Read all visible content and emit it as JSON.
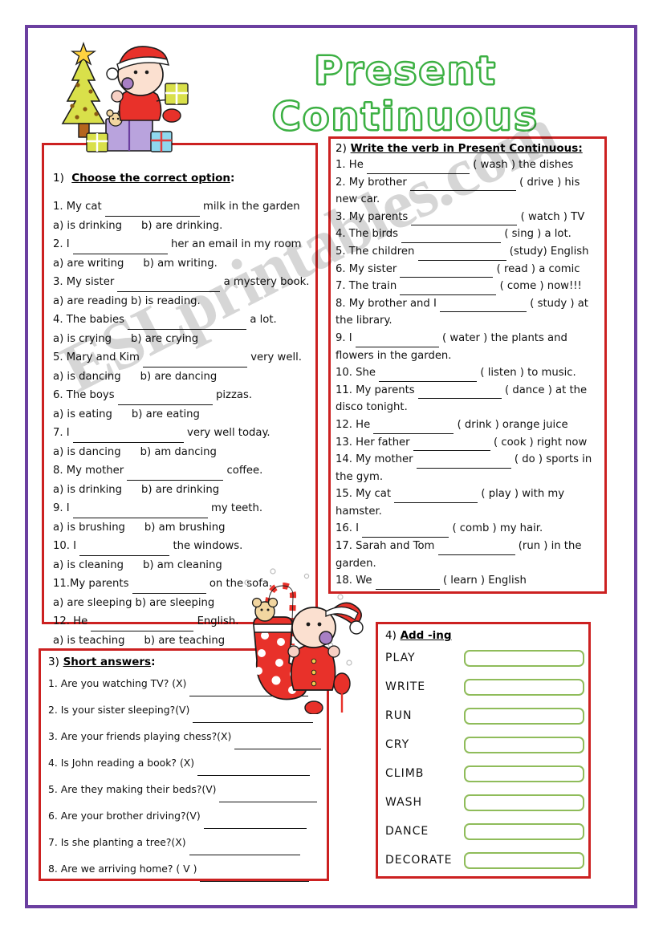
{
  "page": {
    "title": "Present Continuous",
    "watermark": "ESLprintables.com",
    "border_color": "#6b3fa0",
    "box_border_color": "#cc2121",
    "title_color": "#3cb043",
    "answer_box_color": "#8fbc5a"
  },
  "exercise1": {
    "number": "1)",
    "heading": "Choose the correct option",
    "heading_suffix": ":",
    "items": [
      {
        "q_pre": "1. My cat",
        "q_post": "milk in the garden",
        "a": "a) is drinking",
        "b": "b) are drinking."
      },
      {
        "q_pre": "2. I",
        "q_post": "her  an email in my room",
        "a": "a) are writing",
        "b": "b) am writing."
      },
      {
        "q_pre": "3. My sister",
        "q_post": "a mystery book.",
        "a": "a) are reading",
        "b": "b) is reading."
      },
      {
        "q_pre": "4. The babies",
        "q_post": "a lot.",
        "a": "a) is crying",
        "b": "b) are crying"
      },
      {
        "q_pre": "5. Mary and Kim",
        "q_post": "very well.",
        "a": "a) is dancing",
        "b": "b) are dancing"
      },
      {
        "q_pre": "6. The boys",
        "q_post": "pizzas.",
        "a": "a) is eating",
        "b": "b) are eating"
      },
      {
        "q_pre": "7. I",
        "q_post": "very well today.",
        "a": "a) is dancing",
        "b": "b) am dancing"
      },
      {
        "q_pre": "8. My mother",
        "q_post": "coffee.",
        "a": "a) is drinking",
        "b": "b) are drinking"
      },
      {
        "q_pre": "9. I",
        "q_post": "my teeth.",
        "a": "a) is brushing",
        "b": "b) am brushing"
      },
      {
        "q_pre": "10. I",
        "q_post": "the windows.",
        "a": "a) is cleaning",
        "b": "b) am cleaning"
      },
      {
        "q_pre": "11.My parents",
        "q_post": "on the sofa.",
        "a": "a) are sleeping",
        "b": "b) are sleeping"
      },
      {
        "q_pre": "12. He",
        "q_post": "English.",
        "a": "a) is teaching",
        "b": "b) are teaching"
      }
    ]
  },
  "exercise2": {
    "number": "2)",
    "heading": "Write the verb in Present Continuous:",
    "items": [
      {
        "pre": "1.  He",
        "post": "( wash ) the dishes"
      },
      {
        "pre": "2. My brother",
        "post": "( drive ) his new car."
      },
      {
        "pre": "3. My parents",
        "post": "( watch ) TV"
      },
      {
        "pre": "4. The birds",
        "post": "( sing ) a lot."
      },
      {
        "pre": "5. The children",
        "post": "(study) English"
      },
      {
        "pre": "6. My sister",
        "post": "( read ) a comic"
      },
      {
        "pre": "7. The train",
        "post": "( come ) now!!!"
      },
      {
        "pre": "8. My brother and I",
        "post": "( study ) at the library."
      },
      {
        "pre": "9. I",
        "post": "( water ) the plants and flowers in the garden."
      },
      {
        "pre": "10. She",
        "post": "( listen ) to music."
      },
      {
        "pre": "11. My parents",
        "post": "( dance ) at the disco tonight."
      },
      {
        "pre": "12. He",
        "post": "( drink ) orange juice"
      },
      {
        "pre": "13. Her father",
        "post": "( cook ) right now"
      },
      {
        "pre": "14. My mother",
        "post": "( do ) sports in the gym."
      },
      {
        "pre": "15. My cat",
        "post": "( play ) with my hamster."
      },
      {
        "pre": "16. I",
        "post": "( comb ) my hair."
      },
      {
        "pre": "17. Sarah and Tom",
        "post": "(run ) in the garden."
      },
      {
        "pre": "18. We",
        "post": "( learn ) English"
      }
    ]
  },
  "exercise3": {
    "number": "3)",
    "heading": "Short answers",
    "heading_suffix": ":",
    "items": [
      "1. Are you watching TV? (X)",
      "2. Is your sister sleeping?(V)",
      "3. Are your friends playing chess?(X)",
      "4. Is John reading a book? (X)",
      "5. Are they making their beds?(V)",
      "6. Are your brother driving?(V)",
      "7. Is she planting a tree?(X)",
      "8. Are we arriving home? ( V )"
    ]
  },
  "exercise4": {
    "number": "4)",
    "heading": "Add -ing",
    "words": [
      "PLAY",
      "WRITE",
      "RUN",
      "CRY",
      "CLIMB",
      "WASH",
      "DANCE",
      "DECORATE"
    ]
  },
  "clipart": {
    "top": "christmas-baby-with-tree-and-presents",
    "middle": "christmas-baby-with-stocking-and-teddy"
  }
}
